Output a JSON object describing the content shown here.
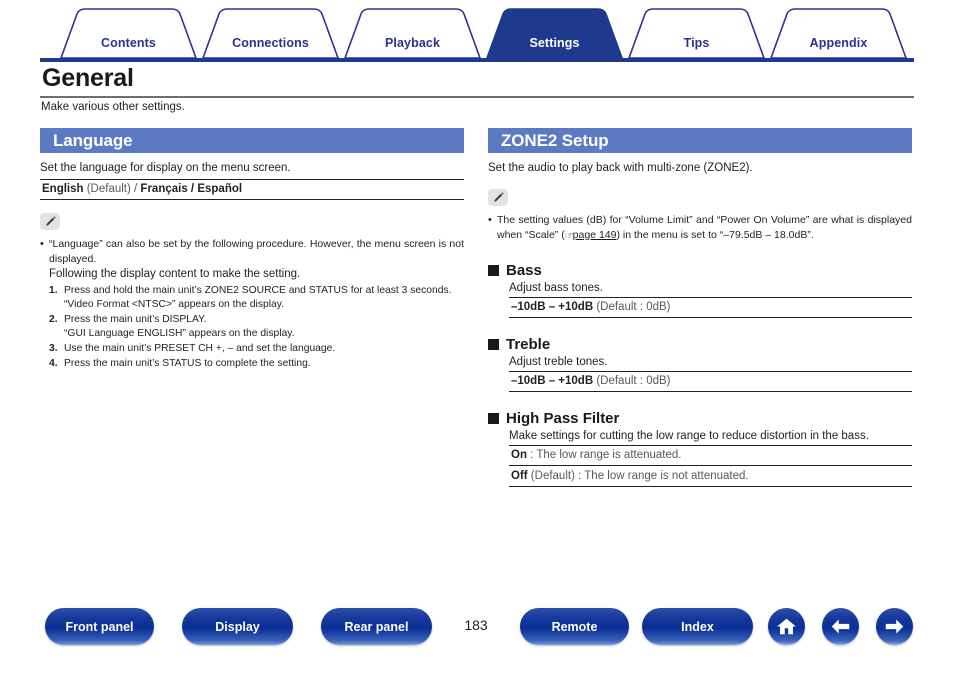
{
  "tabs": [
    {
      "label": "Contents",
      "active": false
    },
    {
      "label": "Connections",
      "active": false
    },
    {
      "label": "Playback",
      "active": false
    },
    {
      "label": "Settings",
      "active": true
    },
    {
      "label": "Tips",
      "active": false
    },
    {
      "label": "Appendix",
      "active": false
    }
  ],
  "page": {
    "title": "General",
    "intro": "Make various other settings.",
    "number": "183"
  },
  "left": {
    "section_title": "Language",
    "description": "Set the language for display on the menu screen.",
    "options_bold_1": "English",
    "options_rest_1": " (Default) / ",
    "options_bold_2": "Français",
    "options_sep": " / ",
    "options_bold_3": "Español",
    "note": {
      "icon": "pencil-icon",
      "bullet": "•",
      "text": "“Language” can also be set by the following procedure. However, the menu screen is not displayed.",
      "subtext": "Following the display content to make the setting.",
      "steps": [
        {
          "num": "1.",
          "text": "Press and hold the main unit’s ZONE2 SOURCE and STATUS for at least 3 seconds.",
          "sub": "“Video Format <NTSC>” appears on the display."
        },
        {
          "num": "2.",
          "text": "Press the main unit’s DISPLAY.",
          "sub": "“GUI Language ENGLISH” appears on the display."
        },
        {
          "num": "3.",
          "text": "Use the main unit’s PRESET CH +, – and set the language.",
          "sub": ""
        },
        {
          "num": "4.",
          "text": "Press the main unit’s STATUS to complete the setting.",
          "sub": ""
        }
      ]
    }
  },
  "right": {
    "section_title": "ZONE2 Setup",
    "description": "Set the audio to play back with multi-zone (ZONE2).",
    "note": {
      "icon": "pencil-icon",
      "bullet": "•",
      "text_before": "The setting values (dB) for “Volume Limit” and “Power On Volume” are what is displayed when “Scale” (",
      "link_icon": "pointing-hand-icon",
      "link_text": "page 149",
      "text_after": ") in the menu is set to “–79.5dB – 18.0dB”."
    },
    "subsections": [
      {
        "heading": "Bass",
        "desc": "Adjust bass tones.",
        "options": [
          {
            "bold": "–10dB – +10dB",
            "rest": " (Default : 0dB)"
          }
        ]
      },
      {
        "heading": "Treble",
        "desc": "Adjust treble tones.",
        "options": [
          {
            "bold": "–10dB – +10dB",
            "rest": " (Default : 0dB)"
          }
        ]
      },
      {
        "heading": "High Pass Filter",
        "desc": "Make settings for cutting the low range to reduce distortion in the bass.",
        "options": [
          {
            "bold": "On",
            "rest": " : The low range is attenuated."
          },
          {
            "bold": "Off",
            "rest": " (Default) : The low range is not attenuated."
          }
        ]
      }
    ]
  },
  "footer": {
    "buttons": [
      {
        "label": "Front panel"
      },
      {
        "label": "Display"
      },
      {
        "label": "Rear panel"
      },
      {
        "label": "Remote"
      },
      {
        "label": "Index"
      }
    ],
    "icons": [
      {
        "name": "home-icon"
      },
      {
        "name": "arrow-left-icon"
      },
      {
        "name": "arrow-right-icon"
      }
    ]
  },
  "colors": {
    "tab_active_bg": "#1e3a8c",
    "tab_text": "#2e3192",
    "section_header_bg": "#5c79c4",
    "button_blue": "#0a2f96"
  }
}
